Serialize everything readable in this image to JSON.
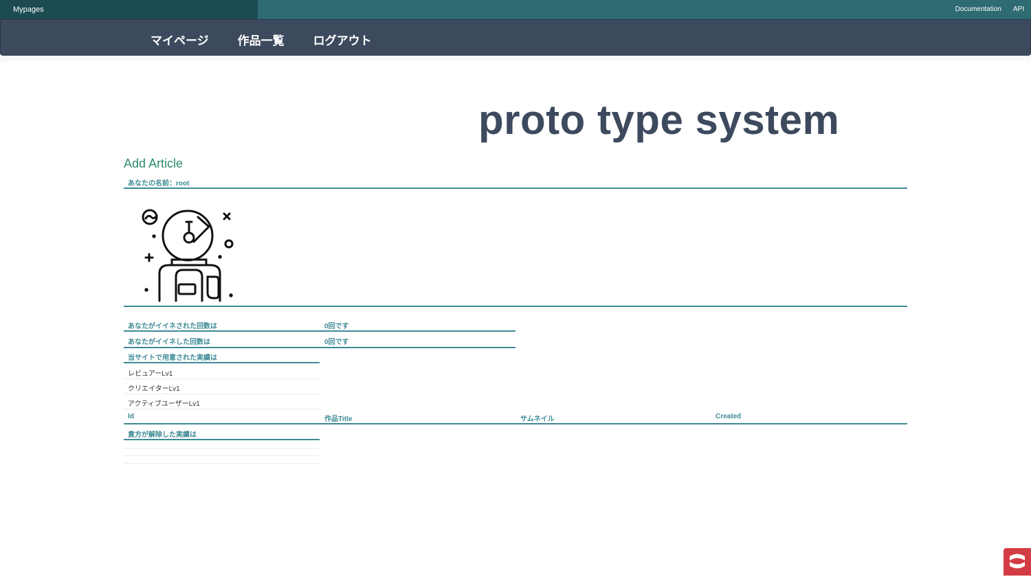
{
  "topbar": {
    "brand": "Mypages",
    "links": [
      "Documentation",
      "API"
    ]
  },
  "nav": {
    "items": [
      "マイページ",
      "作品一覧",
      "ログアウト"
    ]
  },
  "page": {
    "title": "proto type system"
  },
  "content": {
    "add_article": "Add Article",
    "user_name_line": "あなたの名前：root",
    "stats": [
      {
        "label": "あなたがイイネされた回数は",
        "value": "0回です"
      },
      {
        "label": "あなたがイイネした回数は",
        "value": "0回です"
      }
    ],
    "achievements_heading": "当サイトで用意された実績は",
    "achievements": [
      "レビュアーLv1",
      "クリエイターLv1",
      "アクティブユーザーLv1"
    ],
    "table_headers": [
      "Id",
      "作品Title",
      "サムネイル",
      "Created"
    ],
    "unlocked_heading": "貴方が解除した実績は"
  },
  "colors": {
    "nav_bg": "#3d4a5e",
    "topbar_bg": "#2e6b73",
    "accent": "#3d8a94",
    "link": "#2e8a6b",
    "badge": "#d33c44"
  },
  "icons": {
    "avatar": "astronaut-icon",
    "badge": "cakephp-logo-icon"
  }
}
